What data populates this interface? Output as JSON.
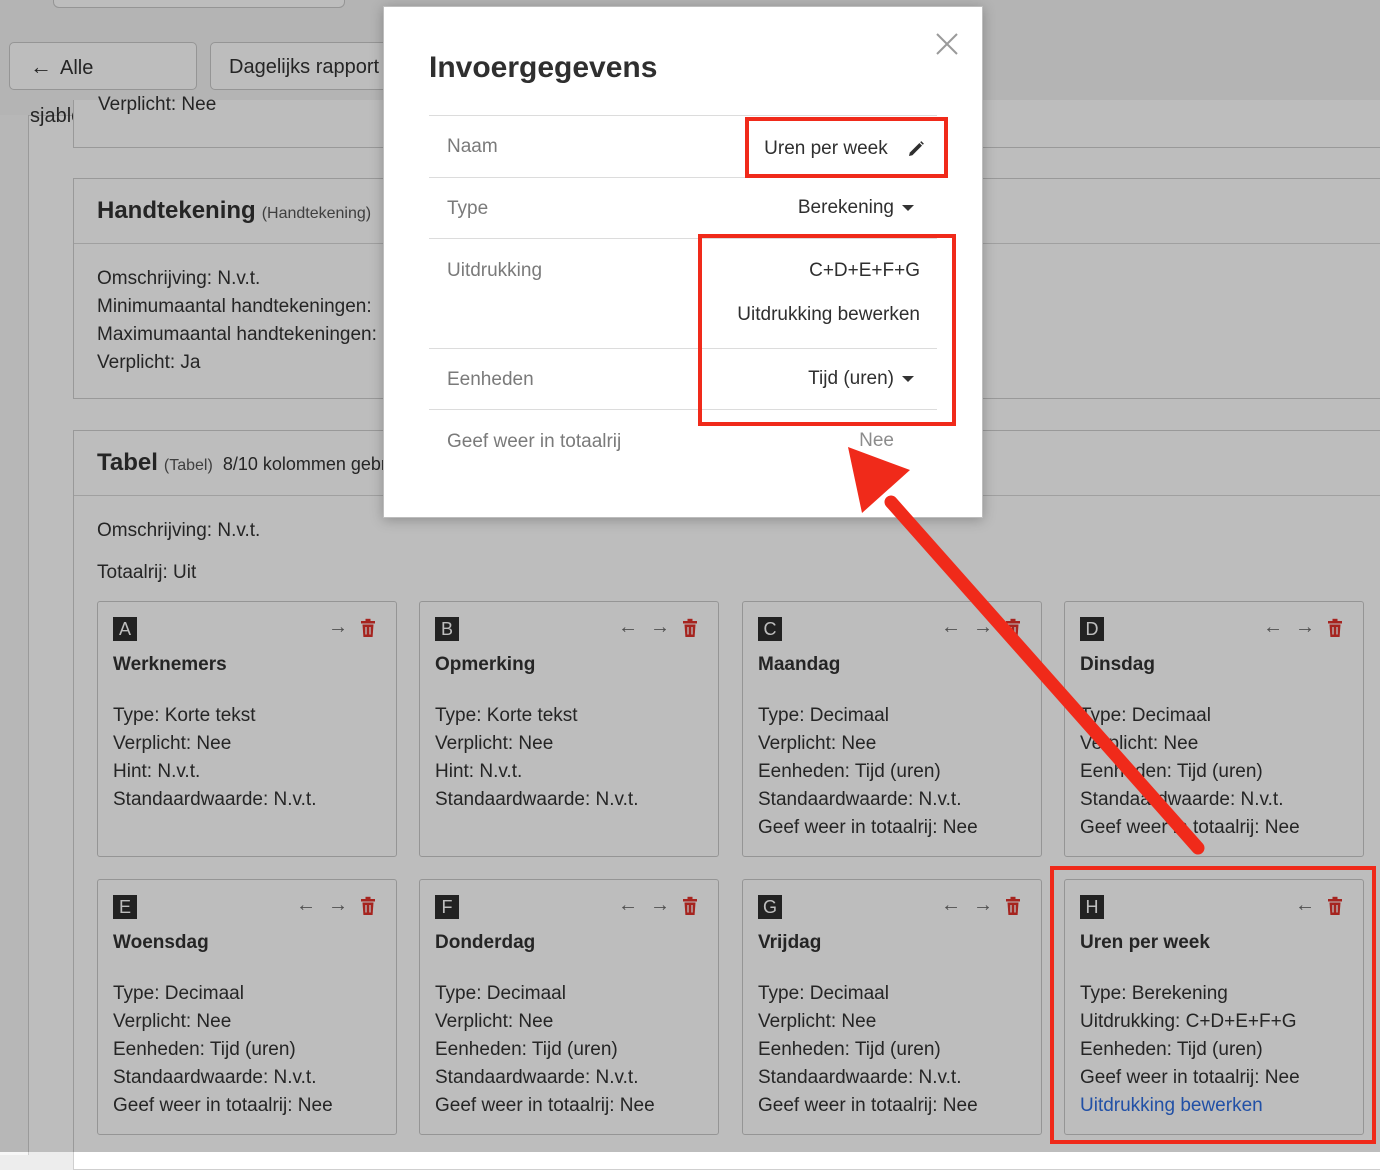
{
  "toolbar": {
    "back_label": "Alle sjablonen",
    "daily_report_label": "Dagelijks rapport"
  },
  "partial_section": {
    "cut_text": "Verplicht: Nee"
  },
  "signature_section": {
    "title": "Handtekening",
    "subtitle": "(Handtekening)",
    "lines": [
      "Omschrijving: N.v.t.",
      "Minimumaantal handtekeningen:",
      "Maximumaantal handtekeningen:",
      "Verplicht: Ja"
    ]
  },
  "table_section": {
    "title": "Tabel",
    "subtitle": "(Tabel)",
    "columns_used": "8/10 kolommen gebr",
    "description": "Omschrijving: N.v.t.",
    "total_row": "Totaalrij: Uit",
    "cards": [
      {
        "letter": "A",
        "name": "Werknemers",
        "lines": [
          "Type: Korte tekst",
          "Verplicht: Nee",
          "Hint: N.v.t.",
          "Standaardwaarde: N.v.t."
        ],
        "link": ""
      },
      {
        "letter": "B",
        "name": "Opmerking",
        "lines": [
          "Type: Korte tekst",
          "Verplicht: Nee",
          "Hint: N.v.t.",
          "Standaardwaarde: N.v.t."
        ],
        "link": ""
      },
      {
        "letter": "C",
        "name": "Maandag",
        "lines": [
          "Type: Decimaal",
          "Verplicht: Nee",
          "Eenheden: Tijd (uren)",
          "Standaardwaarde: N.v.t.",
          "Geef weer in totaalrij: Nee"
        ],
        "link": ""
      },
      {
        "letter": "D",
        "name": "Dinsdag",
        "lines": [
          "Type: Decimaal",
          "Verplicht: Nee",
          "Eenheden: Tijd (uren)",
          "Standaardwaarde: N.v.t.",
          "Geef weer in totaalrij: Nee"
        ],
        "link": ""
      },
      {
        "letter": "E",
        "name": "Woensdag",
        "lines": [
          "Type: Decimaal",
          "Verplicht: Nee",
          "Eenheden: Tijd (uren)",
          "Standaardwaarde: N.v.t.",
          "Geef weer in totaalrij: Nee"
        ],
        "link": ""
      },
      {
        "letter": "F",
        "name": "Donderdag",
        "lines": [
          "Type: Decimaal",
          "Verplicht: Nee",
          "Eenheden: Tijd (uren)",
          "Standaardwaarde: N.v.t.",
          "Geef weer in totaalrij: Nee"
        ],
        "link": ""
      },
      {
        "letter": "G",
        "name": "Vrijdag",
        "lines": [
          "Type: Decimaal",
          "Verplicht: Nee",
          "Eenheden: Tijd (uren)",
          "Standaardwaarde: N.v.t.",
          "Geef weer in totaalrij: Nee"
        ],
        "link": ""
      },
      {
        "letter": "H",
        "name": "Uren per week",
        "lines": [
          "Type: Berekening",
          "Uitdrukking: C+D+E+F+G",
          "Eenheden: Tijd (uren)",
          "Geef weer in totaalrij: Nee"
        ],
        "link": "Uitdrukking bewerken"
      }
    ]
  },
  "modal": {
    "title": "Invoergegevens",
    "rows": {
      "name_label": "Naam",
      "name_value": "Uren per week",
      "type_label": "Type",
      "type_value": "Berekening",
      "expression_label": "Uitdrukking",
      "expression_value": "C+D+E+F+G",
      "expression_link": "Uitdrukking bewerken",
      "units_label": "Eenheden",
      "units_value": "Tijd (uren)",
      "total_label": "Geef weer in totaalrij",
      "total_value": "Nee"
    }
  },
  "colors": {
    "highlight": "#f02a1a",
    "link": "#2d6ce0",
    "trash": "#e0312b"
  },
  "icons": [
    "arrow-left-icon",
    "arrow-right-icon",
    "trash-icon",
    "close-icon",
    "pencil-icon",
    "caret-down-icon"
  ]
}
